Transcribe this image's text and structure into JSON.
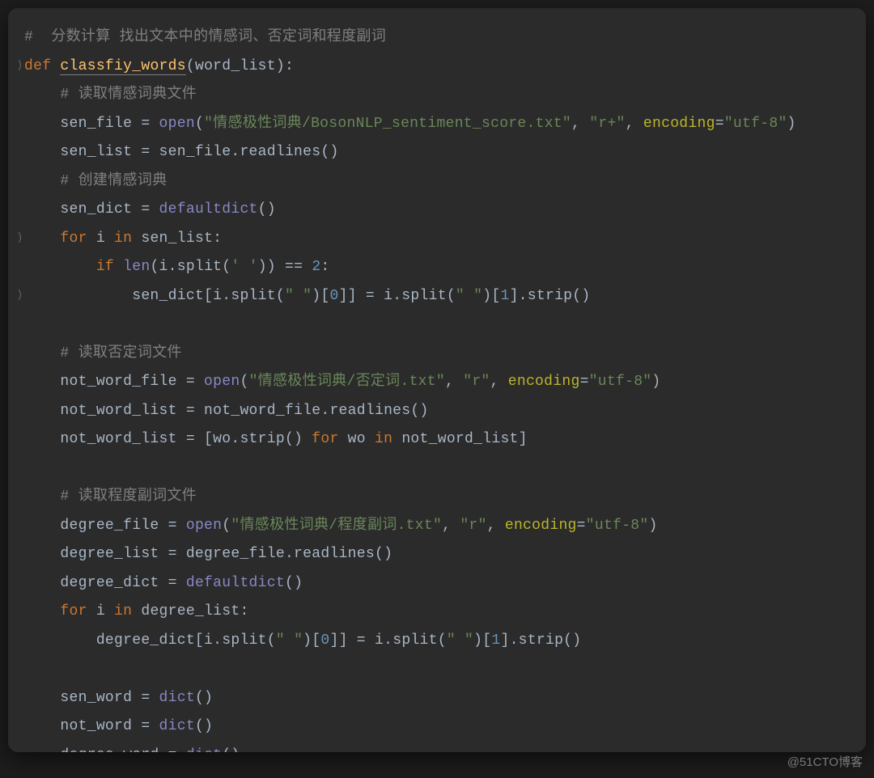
{
  "watermark": "@51CTO博客",
  "code": {
    "l1": {
      "full": "#  分数计算 找出文本中的情感词、否定词和程度副词"
    },
    "l2": {
      "kw_def": "def",
      "fn": "classfiy_words",
      "open": "(word_list):"
    },
    "l3": {
      "full": "    # 读取情感词典文件"
    },
    "l4": {
      "pre": "    sen_file = ",
      "bi": "open",
      "p1": "(",
      "s1": "\"情感极性词典/BosonNLP_sentiment_score.txt\"",
      "c1": ", ",
      "s2": "\"r+\"",
      "c2": ", ",
      "k1": "encoding",
      "eq": "=",
      "s3": "\"utf-8\"",
      "p2": ")"
    },
    "l5": {
      "full": "    sen_list = sen_file.readlines()"
    },
    "l6": {
      "full": "    # 创建情感词典"
    },
    "l7": {
      "pre": "    sen_dict = ",
      "bi": "defaultdict",
      "tail": "()"
    },
    "l8": {
      "kw1": "    for",
      "mid": " i ",
      "kw2": "in",
      "tail": " sen_list:"
    },
    "l9": {
      "kw1": "        if",
      "sp": " ",
      "bi": "len",
      "p1": "(i.split(",
      "s1": "' '",
      "p2": ")) == ",
      "num": "2",
      "tail": ":"
    },
    "l10": {
      "pre": "            sen_dict[i.split(",
      "s1": "\" \"",
      "mid": ")[",
      "num1": "0",
      "mid2": "]] = i.split(",
      "s2": "\" \"",
      "mid3": ")[",
      "num2": "1",
      "tail": "].strip()"
    },
    "l12": {
      "full": "    # 读取否定词文件"
    },
    "l13": {
      "pre": "    not_word_file = ",
      "bi": "open",
      "p1": "(",
      "s1": "\"情感极性词典/否定词.txt\"",
      "c1": ", ",
      "s2": "\"r\"",
      "c2": ", ",
      "k1": "encoding",
      "eq": "=",
      "s3": "\"utf-8\"",
      "p2": ")"
    },
    "l14": {
      "full": "    not_word_list = not_word_file.readlines()"
    },
    "l15": {
      "pre": "    not_word_list = [wo.strip() ",
      "kw1": "for",
      "mid": " wo ",
      "kw2": "in",
      "tail": " not_word_list]"
    },
    "l17": {
      "full": "    # 读取程度副词文件"
    },
    "l18": {
      "pre": "    degree_file = ",
      "bi": "open",
      "p1": "(",
      "s1": "\"情感极性词典/程度副词.txt\"",
      "c1": ", ",
      "s2": "\"r\"",
      "c2": ", ",
      "k1": "encoding",
      "eq": "=",
      "s3": "\"utf-8\"",
      "p2": ")"
    },
    "l19": {
      "full": "    degree_list = degree_file.readlines()"
    },
    "l20": {
      "pre": "    degree_dict = ",
      "bi": "defaultdict",
      "tail": "()"
    },
    "l21": {
      "kw1": "    for",
      "mid": " i ",
      "kw2": "in",
      "tail": " degree_list:"
    },
    "l22": {
      "pre": "        degree_dict[i.split(",
      "s1": "\" \"",
      "mid": ")[",
      "num1": "0",
      "mid2": "]] = i.split(",
      "s2": "\" \"",
      "mid3": ")[",
      "num2": "1",
      "tail": "].strip()"
    },
    "l24": {
      "pre": "    sen_word = ",
      "bi": "dict",
      "tail": "()"
    },
    "l25": {
      "pre": "    not_word = ",
      "bi": "dict",
      "tail": "()"
    },
    "l26": {
      "pre": "    degree_word = ",
      "bi": "dict",
      "tail": "()"
    }
  }
}
